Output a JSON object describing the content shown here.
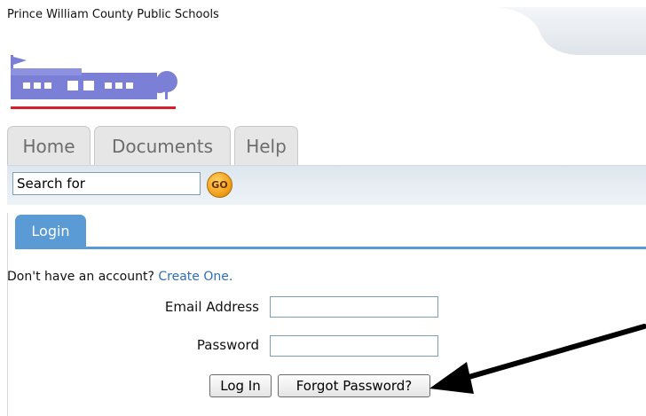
{
  "header": {
    "org_name": "Prince William County Public Schools",
    "logo": "school-building-logo"
  },
  "nav": {
    "tabs": [
      {
        "label": "Home"
      },
      {
        "label": "Documents"
      },
      {
        "label": "Help"
      }
    ]
  },
  "search": {
    "value": "Search for",
    "go_label": "GO"
  },
  "login": {
    "tab_label": "Login",
    "signup_prompt": "Don't have an account?",
    "signup_link": "Create One.",
    "email_label": "Email Address",
    "email_value": "",
    "password_label": "Password",
    "password_value": "",
    "login_button": "Log In",
    "forgot_button": "Forgot Password?"
  },
  "annotation": {
    "icon": "arrow-pointer-icon",
    "color": "#000000"
  },
  "colors": {
    "accent": "#5b9bd5",
    "link": "#2f6fb6",
    "go_button": "#f2a21a"
  }
}
